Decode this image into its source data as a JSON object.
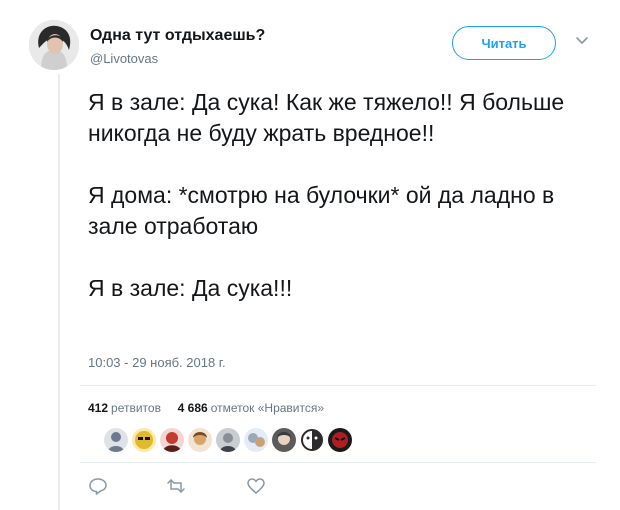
{
  "user": {
    "name": "Одна тут отдыхаешь?",
    "handle": "@Livotovas",
    "avatar_icon": "user-avatar-photo"
  },
  "follow_label": "Читать",
  "menu_icon": "chevron-down-icon",
  "tweet": {
    "paragraphs": [
      "Я в зале: Да сука! Как же тяжело!! Я больше никогда не буду жрать вредное!!",
      "Я дома: *смотрю на булочки* ой да ладно в зале отработаю",
      "Я в зале: Да сука!!!"
    ]
  },
  "timestamp": "10:03 - 29 нояб. 2018 г.",
  "stats": {
    "retweets_count": "412",
    "retweets_label": "ретвитов",
    "likes_count": "4 686",
    "likes_label": "отметок «Нравится»"
  },
  "likers": [
    {
      "icon": "liker-avatar-1",
      "color": "#6d7a8c"
    },
    {
      "icon": "liker-avatar-2",
      "color": "#e0b92c"
    },
    {
      "icon": "liker-avatar-3",
      "color": "#c23b2e"
    },
    {
      "icon": "liker-avatar-4",
      "color": "#d9a36b"
    },
    {
      "icon": "liker-avatar-5",
      "color": "#8a8f96"
    },
    {
      "icon": "liker-avatar-6",
      "color": "#9aa9b8"
    },
    {
      "icon": "liker-avatar-7",
      "color": "#3a3a3a"
    },
    {
      "icon": "liker-avatar-8",
      "color": "#2b2b2b"
    },
    {
      "icon": "liker-avatar-9",
      "color": "#b01e23"
    }
  ],
  "actions": [
    {
      "icon": "reply-icon"
    },
    {
      "icon": "retweet-icon"
    },
    {
      "icon": "like-icon"
    }
  ],
  "colors": {
    "accent": "#1da1f2",
    "text": "#14171a",
    "secondary": "#657786",
    "border": "#e6ecf0"
  }
}
